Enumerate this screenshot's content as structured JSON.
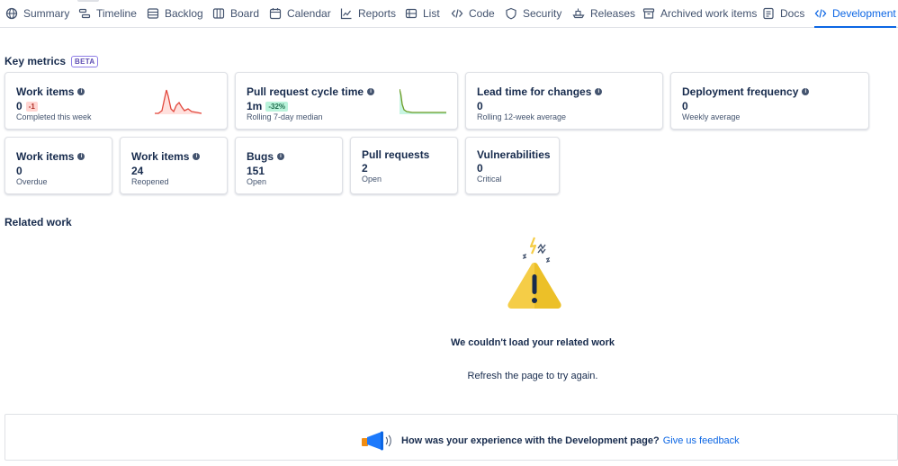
{
  "nav": {
    "tabs": [
      {
        "label": "Summary",
        "icon": "globe-icon"
      },
      {
        "label": "Timeline",
        "icon": "timeline-icon"
      },
      {
        "label": "Backlog",
        "icon": "backlog-icon"
      },
      {
        "label": "Board",
        "icon": "board-icon"
      },
      {
        "label": "Calendar",
        "icon": "calendar-icon"
      },
      {
        "label": "Reports",
        "icon": "chart-line-icon"
      },
      {
        "label": "List",
        "icon": "list-icon"
      },
      {
        "label": "Code",
        "icon": "code-icon"
      },
      {
        "label": "Security",
        "icon": "shield-icon"
      },
      {
        "label": "Releases",
        "icon": "ship-icon"
      },
      {
        "label": "Archived work items",
        "icon": "archive-icon"
      },
      {
        "label": "Docs",
        "icon": "page-icon"
      },
      {
        "label": "Development",
        "icon": "code-icon"
      }
    ],
    "active_tab": "Development"
  },
  "key_metrics": {
    "title": "Key metrics",
    "badge": "BETA",
    "cards": [
      {
        "title": "Work items",
        "value": "0",
        "delta": "-1",
        "subtitle": "Completed this week",
        "has_info": true
      },
      {
        "title": "Pull request cycle time",
        "value": "1m",
        "delta": "-32%",
        "subtitle": "Rolling 7-day median",
        "has_info": true
      },
      {
        "title": "Lead time for changes",
        "value": "0",
        "subtitle": "Rolling 12-week average",
        "has_info": true
      },
      {
        "title": "Deployment frequency",
        "value": "0",
        "subtitle": "Weekly average",
        "has_info": true
      },
      {
        "title": "Work items",
        "value": "0",
        "subtitle": "Overdue",
        "has_info": true
      },
      {
        "title": "Work items",
        "value": "24",
        "subtitle": "Reopened",
        "has_info": true
      },
      {
        "title": "Bugs",
        "value": "151",
        "subtitle": "Open",
        "has_info": true
      },
      {
        "title": "Pull requests",
        "value": "2",
        "subtitle": "Open",
        "has_info": false
      },
      {
        "title": "Vulnerabilities",
        "value": "0",
        "subtitle": "Critical",
        "has_info": false
      }
    ]
  },
  "related_work": {
    "title": "Related work",
    "error_title": "We couldn't load your related work",
    "error_body": "Refresh the page to try again."
  },
  "feedback": {
    "question": "How was your experience with the Development page?",
    "link": "Give us feedback"
  },
  "colors": {
    "accent": "#0c66e4",
    "sparkline_red": "#e2483d",
    "sparkline_green": "#6a9a23",
    "warning_yellow": "#f5cd47"
  }
}
